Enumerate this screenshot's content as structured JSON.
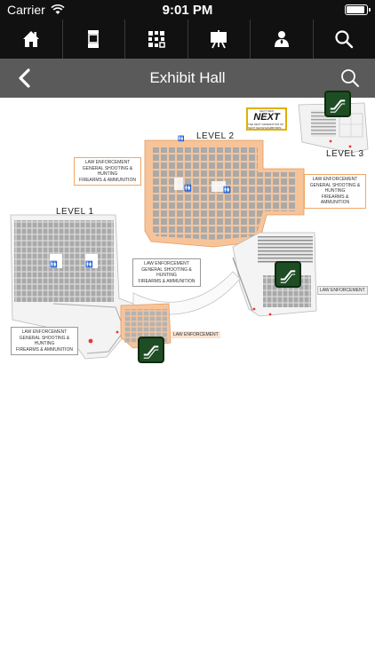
{
  "status_bar": {
    "carrier": "Carrier",
    "time": "9:01 PM",
    "battery_level": 0.95
  },
  "toolbar": {
    "items": [
      {
        "icon": "home-icon"
      },
      {
        "icon": "booth-kiosk-icon"
      },
      {
        "icon": "qr-code-icon"
      },
      {
        "icon": "presentation-easel-icon"
      },
      {
        "icon": "speaker-person-icon"
      },
      {
        "icon": "search-icon"
      }
    ]
  },
  "navbar": {
    "title": "Exhibit Hall",
    "back_icon": "chevron-left-icon",
    "search_icon": "search-icon"
  },
  "map": {
    "levels": {
      "level1": "LEVEL 1",
      "level2": "LEVEL 2",
      "level3": "LEVEL 3"
    },
    "callouts": {
      "upper_left": [
        "LAW ENFORCEMENT",
        "GENERAL SHOOTING & HUNTING",
        "FIREARMS & AMMUNITION"
      ],
      "upper_right": [
        "LAW ENFORCEMENT",
        "GENERAL SHOOTING & HUNTING",
        "FIREARMS & AMMUNITION"
      ],
      "middle": [
        "LAW ENFORCEMENT",
        "GENERAL SHOOTING & HUNTING",
        "FIREARMS & AMMUNITION"
      ],
      "lower_left": [
        "LAW ENFORCEMENT",
        "GENERAL SHOOTING & HUNTING",
        "FIREARMS & AMMUNITION"
      ]
    },
    "tags": {
      "right": "LAW ENFORCEMENT",
      "bottom": "LAW ENFORCEMENT"
    },
    "logo": {
      "top_text": "SHOT NEW",
      "main_text": "NEXT",
      "bottom_text": "THE NEXT GENERATION OF SHOT SHOW EXHIBITORS"
    },
    "colors": {
      "booth_orange": "#f7c49a",
      "booth_gray": "#a9a9a9",
      "escalator_green": "#1e4d23"
    }
  }
}
